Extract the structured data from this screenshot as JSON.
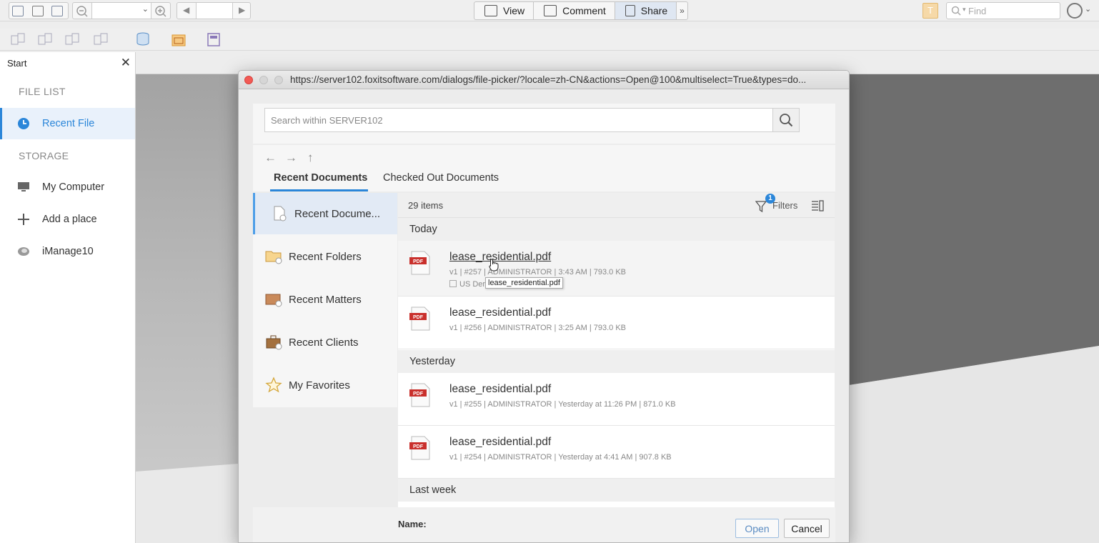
{
  "toolbar": {
    "view_label": "View",
    "comment_label": "Comment",
    "share_label": "Share",
    "find_placeholder": "Find"
  },
  "start_tab": {
    "label": "Start",
    "close_label": "✕"
  },
  "sidebar": {
    "file_list_heading": "FILE LIST",
    "storage_heading": "STORAGE",
    "items": [
      {
        "label": "Recent File",
        "icon": "clock-icon"
      },
      {
        "label": "My Computer",
        "icon": "monitor-icon"
      },
      {
        "label": "Add a place",
        "icon": "plus-icon"
      },
      {
        "label": "iManage10",
        "icon": "cloud-drive-icon"
      }
    ]
  },
  "dialog": {
    "url": "https://server102.foxitsoftware.com/dialogs/file-picker/?locale=zh-CN&actions=Open@100&multiselect=True&types=do...",
    "search_placeholder": "Search within SERVER102",
    "tabs": [
      "Recent Documents",
      "Checked Out Documents"
    ],
    "left_nav": [
      {
        "label": "Recent Docume...",
        "icon": "recent-document-icon"
      },
      {
        "label": "Recent Folders",
        "icon": "recent-folder-icon"
      },
      {
        "label": "Recent Matters",
        "icon": "recent-matter-icon"
      },
      {
        "label": "Recent Clients",
        "icon": "recent-client-icon"
      },
      {
        "label": "My Favorites",
        "icon": "star-icon"
      }
    ],
    "items_count": "29 items",
    "filters_label": "Filters",
    "filters_badge": "1",
    "groups": [
      "Today",
      "Yesterday",
      "Last week"
    ],
    "files": [
      {
        "name": "lease_residential.pdf",
        "meta": "v1 | #257 | ADMINISTRATOR | 3:43 AM | 793.0 KB",
        "extra": "US Der"
      },
      {
        "name": "lease_residential.pdf",
        "meta": "v1 | #256 | ADMINISTRATOR | 3:25 AM | 793.0 KB"
      },
      {
        "name": "lease_residential.pdf",
        "meta": "v1 | #255 | ADMINISTRATOR | Yesterday at 11:26 PM | 871.0 KB"
      },
      {
        "name": "lease_residential.pdf",
        "meta": "v1 | #254 | ADMINISTRATOR | Yesterday at 4:41 AM | 907.8 KB"
      }
    ],
    "tooltip": "lease_residential.pdf",
    "name_label": "Name:",
    "open_label": "Open",
    "cancel_label": "Cancel"
  },
  "colors": {
    "accent": "#2b86d9",
    "pdf_red": "#c9302c"
  }
}
